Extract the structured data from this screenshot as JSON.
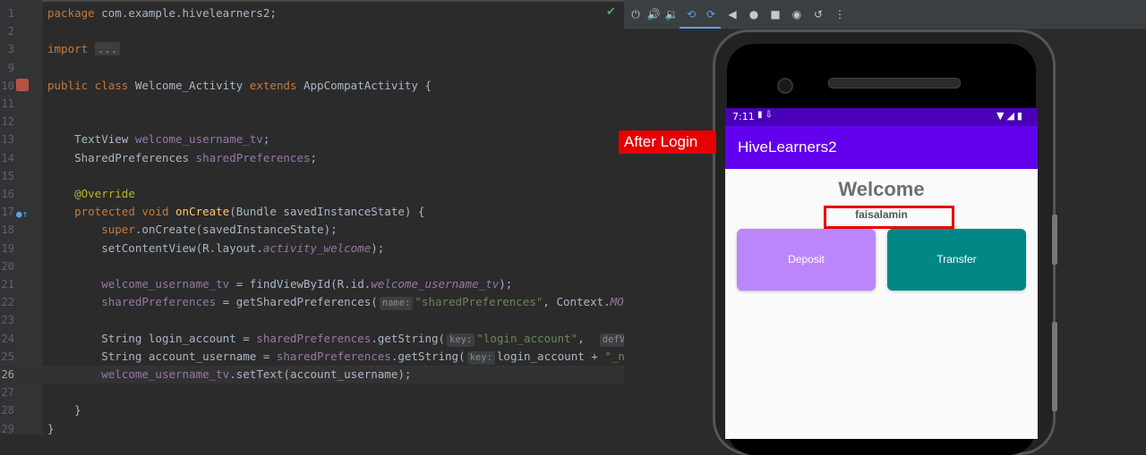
{
  "editor": {
    "lines": [
      {
        "n": "1",
        "html": "<span class='kw'>package</span> com.example.hivelearners2;"
      },
      {
        "n": "2",
        "html": ""
      },
      {
        "n": "3",
        "html": "<span class='kw'>import</span> <span class='fold'>...</span>"
      },
      {
        "n": "9",
        "html": ""
      },
      {
        "n": "10",
        "html": "<span class='kw'>public class</span> Welcome_Activity <span class='kw'>extends</span> AppCompatActivity {"
      },
      {
        "n": "11",
        "html": ""
      },
      {
        "n": "12",
        "html": ""
      },
      {
        "n": "13",
        "html": "    TextView <span class='fld'>welcome_username_tv</span>;"
      },
      {
        "n": "14",
        "html": "    SharedPreferences <span class='fld'>sharedPreferences</span>;"
      },
      {
        "n": "15",
        "html": ""
      },
      {
        "n": "16",
        "html": "    <span class='ann'>@Override</span>"
      },
      {
        "n": "17",
        "html": "    <span class='kw'>protected void</span> <span class='mth'>onCreate</span>(Bundle savedInstanceState) {"
      },
      {
        "n": "18",
        "html": "        <span class='kw'>super</span>.onCreate(savedInstanceState);"
      },
      {
        "n": "19",
        "html": "        setContentView(R.layout.<span class='fld ital'>activity_welcome</span>);"
      },
      {
        "n": "20",
        "html": ""
      },
      {
        "n": "21",
        "html": "        <span class='fld'>welcome_username_tv</span> = findViewById(R.id.<span class='fld ital'>welcome_username_tv</span>);"
      },
      {
        "n": "22",
        "html": "        <span class='fld'>sharedPreferences</span> = getSharedPreferences(<span class='hint'>name:</span><span class='str'>\"sharedPreferences\"</span>, Context.<span class='fld ital'>MODE_PRIVATE</span>);"
      },
      {
        "n": "23",
        "html": ""
      },
      {
        "n": "24",
        "html": "        String login_account = <span class='fld'>sharedPreferences</span>.getString(<span class='hint'>key:</span><span class='str'>\"login_account\"</span>,  <span class='hint'>defValue:</span>"
      },
      {
        "n": "25",
        "html": "        String account_username = <span class='fld'>sharedPreferences</span>.getString(<span class='hint'>key:</span>login_account + <span class='str'>\"_name\"</span>"
      },
      {
        "n": "26",
        "html": "        <span class='fld'>welcome_username_tv</span>.setText(account_username);"
      },
      {
        "n": "27",
        "html": ""
      },
      {
        "n": "28",
        "html": "    }"
      },
      {
        "n": "29",
        "html": "}"
      }
    ]
  },
  "annotation": {
    "label": "After Login"
  },
  "phone": {
    "status_time": "7:11",
    "app_title": "HiveLearners2",
    "welcome_text": "Welcome",
    "username": "faisalamin",
    "deposit_label": "Deposit",
    "transfer_label": "Transfer"
  },
  "toolbar": {
    "icons": [
      "power-icon",
      "volume-up-icon",
      "volume-down-icon",
      "rotate-left-icon",
      "rotate-right-icon",
      "back-icon",
      "home-icon",
      "overview-icon",
      "screenshot-icon",
      "snapshot-icon",
      "more-icon"
    ]
  },
  "colors": {
    "appbar": "#6200ee",
    "deposit": "#bb86fc",
    "transfer": "#018786",
    "highlight": "#e60000"
  }
}
